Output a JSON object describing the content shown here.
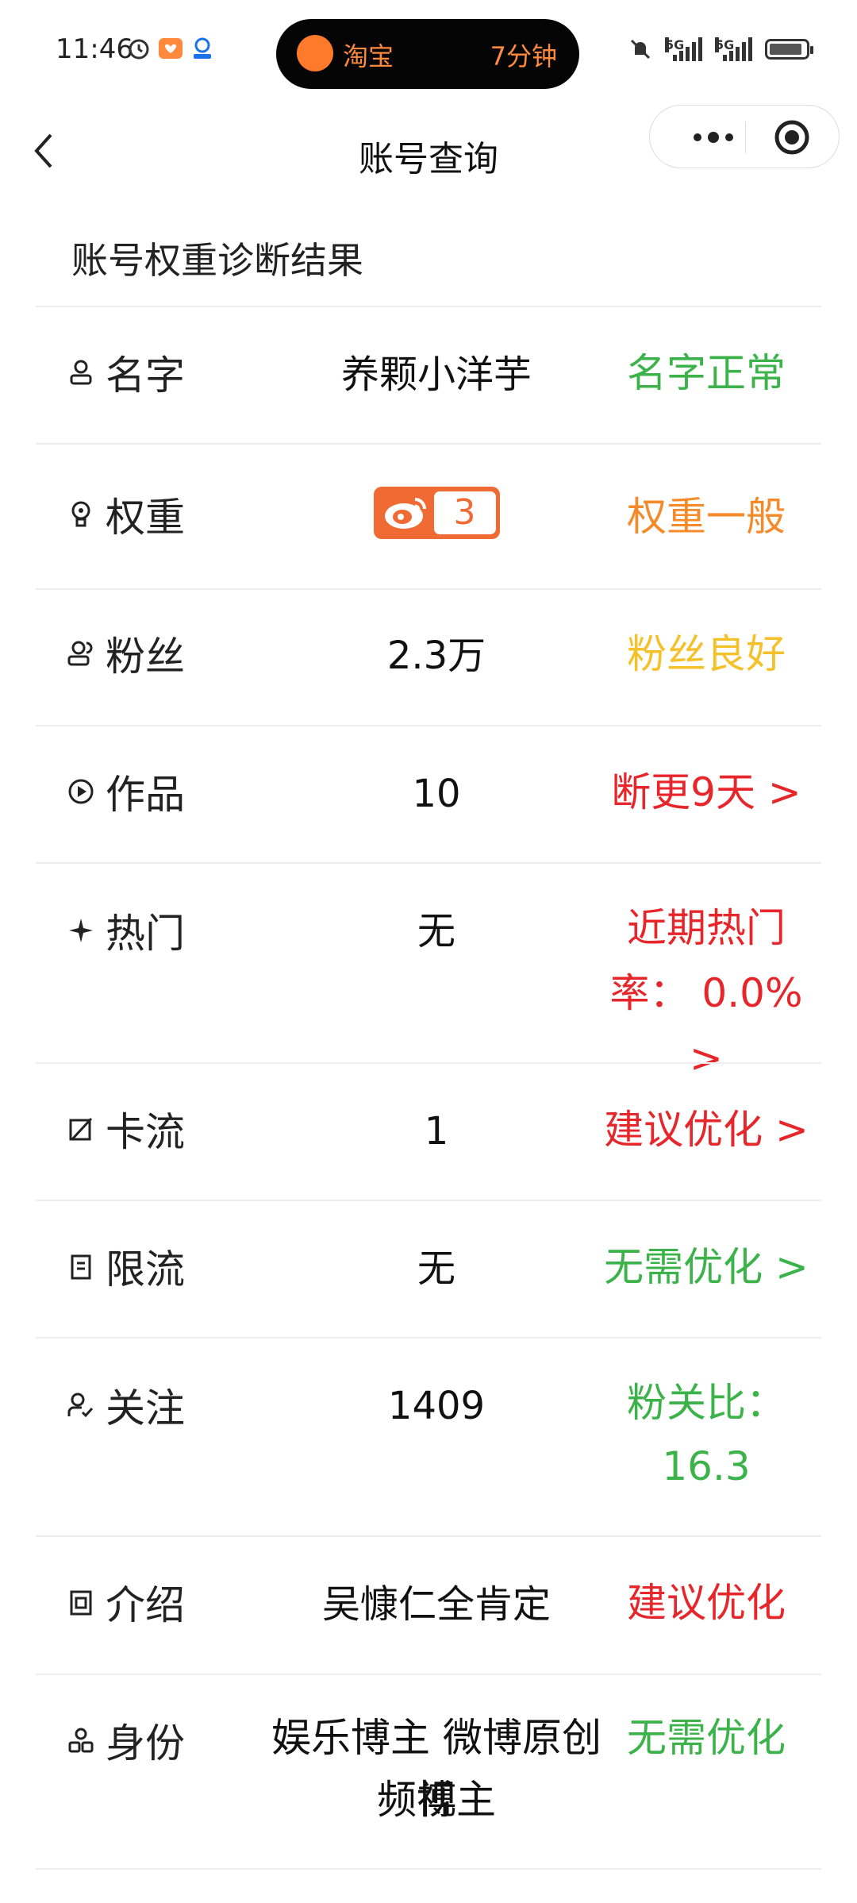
{
  "status_bar": {
    "time": "11:46",
    "island_app": "淘宝",
    "island_duration": "7分钟",
    "network_1": "5G",
    "network_2": "5G"
  },
  "nav": {
    "title": "账号查询"
  },
  "section": {
    "title": "账号权重诊断结果"
  },
  "rows": {
    "name": {
      "label": "名字",
      "value": "养颗小洋芋",
      "status": "名字正常"
    },
    "weight": {
      "label": "权重",
      "value": "3",
      "status": "权重一般"
    },
    "fans": {
      "label": "粉丝",
      "value": "2.3万",
      "status": "粉丝良好"
    },
    "works": {
      "label": "作品",
      "value": "10",
      "status": "断更9天 >"
    },
    "hot": {
      "label": "热门",
      "value": "无",
      "status_line1": "近期热门",
      "status_line2": "率：  0.0% >"
    },
    "stuck": {
      "label": "卡流",
      "value": "1",
      "status": "建议优化 >"
    },
    "limit": {
      "label": "限流",
      "value": "无",
      "status": "无需优化 >"
    },
    "follow": {
      "label": "关注",
      "value": "1409",
      "status_line1": "粉关比：",
      "status_line2": "16.3"
    },
    "intro": {
      "label": "介绍",
      "value": "吴慷仁全肯定",
      "status": "建议优化"
    },
    "identity": {
      "label": "身份",
      "value_line1": "娱乐博主 微博原创视",
      "value_line2": "频博主",
      "status": "无需优化"
    }
  },
  "colors": {
    "green": "#3cb34a",
    "orange": "#f58a2b",
    "yellow": "#f5c12b",
    "red": "#e6262b",
    "pink": "#e94e7d",
    "weibo_badge": "#f06a34"
  }
}
